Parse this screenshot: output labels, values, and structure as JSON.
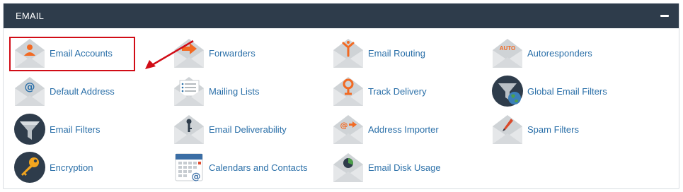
{
  "section": {
    "title": "EMAIL"
  },
  "items": [
    {
      "label": "Email Accounts",
      "icon": "email-accounts-icon"
    },
    {
      "label": "Forwarders",
      "icon": "forwarders-icon"
    },
    {
      "label": "Email Routing",
      "icon": "email-routing-icon"
    },
    {
      "label": "Autoresponders",
      "icon": "autoresponders-icon",
      "icon_text": "AUTO"
    },
    {
      "label": "Default Address",
      "icon": "default-address-icon"
    },
    {
      "label": "Mailing Lists",
      "icon": "mailing-lists-icon"
    },
    {
      "label": "Track Delivery",
      "icon": "track-delivery-icon"
    },
    {
      "label": "Global Email Filters",
      "icon": "global-email-filters-icon"
    },
    {
      "label": "Email Filters",
      "icon": "email-filters-icon"
    },
    {
      "label": "Email Deliverability",
      "icon": "email-deliverability-icon"
    },
    {
      "label": "Address Importer",
      "icon": "address-importer-icon"
    },
    {
      "label": "Spam Filters",
      "icon": "spam-filters-icon"
    },
    {
      "label": "Encryption",
      "icon": "encryption-icon"
    },
    {
      "label": "Calendars and Contacts",
      "icon": "calendars-and-contacts-icon"
    },
    {
      "label": "Email Disk Usage",
      "icon": "email-disk-usage-icon"
    }
  ],
  "colors": {
    "header_bg": "#2e3c4b",
    "link": "#2a6fa8",
    "accent_orange": "#f26a23",
    "annotation_red": "#d10c16"
  }
}
